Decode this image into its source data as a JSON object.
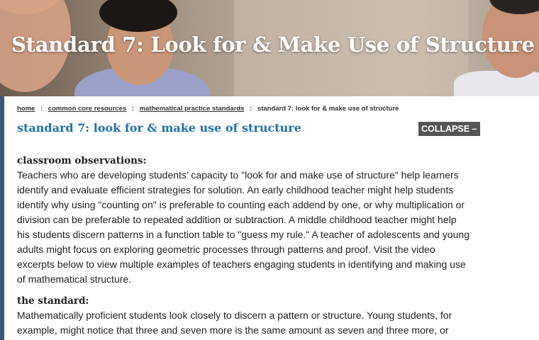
{
  "hero": {
    "title": "Standard 7: Look for & Make Use of Structure"
  },
  "breadcrumb": {
    "items": [
      {
        "label": "home"
      },
      {
        "label": "common core resources"
      },
      {
        "label": "mathematical practice standards"
      }
    ],
    "current": "standard 7: look for & make use of structure",
    "separator": ":"
  },
  "page": {
    "heading": "standard 7: look for & make use of structure",
    "collapse_label": "COLLAPSE –"
  },
  "sections": [
    {
      "title": "classroom observations:",
      "body": "Teachers who are developing students’ capacity to \"look for and make use of structure\" help learners identify and evaluate efficient strategies for solution. An early childhood teacher might help students identify why using \"counting on\" is preferable to counting each addend by one, or why multiplication or division can be preferable to repeated addition or subtraction. A middle childhood teacher might help his students discern patterns in a function table to \"guess my rule.\" A teacher of adolescents and young adults might focus on exploring geometric processes through patterns and proof. Visit the video excerpts below to view multiple examples of teachers engaging students in identifying and making use of mathematical structure."
    },
    {
      "title": "the standard:",
      "body": "Mathematically proficient students look closely to discern a pattern or structure. Young students, for example, might notice that three and seven more is the same amount as seven and three more, or"
    }
  ],
  "colors": {
    "heading_blue": "#1f6fb0",
    "collapse_bg": "#555555",
    "accent_stripe": "#3b5a7a"
  }
}
